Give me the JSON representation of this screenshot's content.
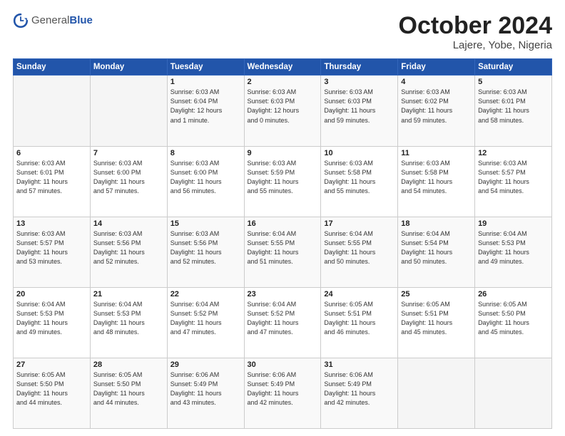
{
  "header": {
    "logo_general": "General",
    "logo_blue": "Blue",
    "month_title": "October 2024",
    "location": "Lajere, Yobe, Nigeria"
  },
  "weekdays": [
    "Sunday",
    "Monday",
    "Tuesday",
    "Wednesday",
    "Thursday",
    "Friday",
    "Saturday"
  ],
  "weeks": [
    [
      {
        "day": "",
        "info": ""
      },
      {
        "day": "",
        "info": ""
      },
      {
        "day": "1",
        "info": "Sunrise: 6:03 AM\nSunset: 6:04 PM\nDaylight: 12 hours\nand 1 minute."
      },
      {
        "day": "2",
        "info": "Sunrise: 6:03 AM\nSunset: 6:03 PM\nDaylight: 12 hours\nand 0 minutes."
      },
      {
        "day": "3",
        "info": "Sunrise: 6:03 AM\nSunset: 6:03 PM\nDaylight: 11 hours\nand 59 minutes."
      },
      {
        "day": "4",
        "info": "Sunrise: 6:03 AM\nSunset: 6:02 PM\nDaylight: 11 hours\nand 59 minutes."
      },
      {
        "day": "5",
        "info": "Sunrise: 6:03 AM\nSunset: 6:01 PM\nDaylight: 11 hours\nand 58 minutes."
      }
    ],
    [
      {
        "day": "6",
        "info": "Sunrise: 6:03 AM\nSunset: 6:01 PM\nDaylight: 11 hours\nand 57 minutes."
      },
      {
        "day": "7",
        "info": "Sunrise: 6:03 AM\nSunset: 6:00 PM\nDaylight: 11 hours\nand 57 minutes."
      },
      {
        "day": "8",
        "info": "Sunrise: 6:03 AM\nSunset: 6:00 PM\nDaylight: 11 hours\nand 56 minutes."
      },
      {
        "day": "9",
        "info": "Sunrise: 6:03 AM\nSunset: 5:59 PM\nDaylight: 11 hours\nand 55 minutes."
      },
      {
        "day": "10",
        "info": "Sunrise: 6:03 AM\nSunset: 5:58 PM\nDaylight: 11 hours\nand 55 minutes."
      },
      {
        "day": "11",
        "info": "Sunrise: 6:03 AM\nSunset: 5:58 PM\nDaylight: 11 hours\nand 54 minutes."
      },
      {
        "day": "12",
        "info": "Sunrise: 6:03 AM\nSunset: 5:57 PM\nDaylight: 11 hours\nand 54 minutes."
      }
    ],
    [
      {
        "day": "13",
        "info": "Sunrise: 6:03 AM\nSunset: 5:57 PM\nDaylight: 11 hours\nand 53 minutes."
      },
      {
        "day": "14",
        "info": "Sunrise: 6:03 AM\nSunset: 5:56 PM\nDaylight: 11 hours\nand 52 minutes."
      },
      {
        "day": "15",
        "info": "Sunrise: 6:03 AM\nSunset: 5:56 PM\nDaylight: 11 hours\nand 52 minutes."
      },
      {
        "day": "16",
        "info": "Sunrise: 6:04 AM\nSunset: 5:55 PM\nDaylight: 11 hours\nand 51 minutes."
      },
      {
        "day": "17",
        "info": "Sunrise: 6:04 AM\nSunset: 5:55 PM\nDaylight: 11 hours\nand 50 minutes."
      },
      {
        "day": "18",
        "info": "Sunrise: 6:04 AM\nSunset: 5:54 PM\nDaylight: 11 hours\nand 50 minutes."
      },
      {
        "day": "19",
        "info": "Sunrise: 6:04 AM\nSunset: 5:53 PM\nDaylight: 11 hours\nand 49 minutes."
      }
    ],
    [
      {
        "day": "20",
        "info": "Sunrise: 6:04 AM\nSunset: 5:53 PM\nDaylight: 11 hours\nand 49 minutes."
      },
      {
        "day": "21",
        "info": "Sunrise: 6:04 AM\nSunset: 5:53 PM\nDaylight: 11 hours\nand 48 minutes."
      },
      {
        "day": "22",
        "info": "Sunrise: 6:04 AM\nSunset: 5:52 PM\nDaylight: 11 hours\nand 47 minutes."
      },
      {
        "day": "23",
        "info": "Sunrise: 6:04 AM\nSunset: 5:52 PM\nDaylight: 11 hours\nand 47 minutes."
      },
      {
        "day": "24",
        "info": "Sunrise: 6:05 AM\nSunset: 5:51 PM\nDaylight: 11 hours\nand 46 minutes."
      },
      {
        "day": "25",
        "info": "Sunrise: 6:05 AM\nSunset: 5:51 PM\nDaylight: 11 hours\nand 45 minutes."
      },
      {
        "day": "26",
        "info": "Sunrise: 6:05 AM\nSunset: 5:50 PM\nDaylight: 11 hours\nand 45 minutes."
      }
    ],
    [
      {
        "day": "27",
        "info": "Sunrise: 6:05 AM\nSunset: 5:50 PM\nDaylight: 11 hours\nand 44 minutes."
      },
      {
        "day": "28",
        "info": "Sunrise: 6:05 AM\nSunset: 5:50 PM\nDaylight: 11 hours\nand 44 minutes."
      },
      {
        "day": "29",
        "info": "Sunrise: 6:06 AM\nSunset: 5:49 PM\nDaylight: 11 hours\nand 43 minutes."
      },
      {
        "day": "30",
        "info": "Sunrise: 6:06 AM\nSunset: 5:49 PM\nDaylight: 11 hours\nand 42 minutes."
      },
      {
        "day": "31",
        "info": "Sunrise: 6:06 AM\nSunset: 5:49 PM\nDaylight: 11 hours\nand 42 minutes."
      },
      {
        "day": "",
        "info": ""
      },
      {
        "day": "",
        "info": ""
      }
    ]
  ]
}
